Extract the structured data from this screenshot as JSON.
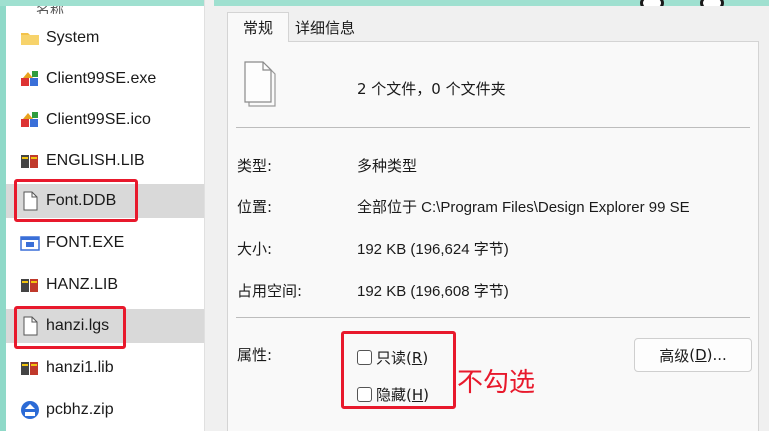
{
  "left_pane": {
    "header": "名称",
    "files": [
      {
        "name": "System",
        "icon": "folder-icon"
      },
      {
        "name": "Client99SE.exe",
        "icon": "exe-app-icon"
      },
      {
        "name": "Client99SE.ico",
        "icon": "exe-app-icon"
      },
      {
        "name": "ENGLISH.LIB",
        "icon": "library-book-icon"
      },
      {
        "name": "Font.DDB",
        "icon": "blank-file-icon"
      },
      {
        "name": "FONT.EXE",
        "icon": "window-exe-icon"
      },
      {
        "name": "HANZ.LIB",
        "icon": "library-book-icon"
      },
      {
        "name": "hanzi.lgs",
        "icon": "blank-file-icon"
      },
      {
        "name": "hanzi1.lib",
        "icon": "library-book-icon"
      },
      {
        "name": "pcbhz.zip",
        "icon": "zip-archive-icon"
      }
    ]
  },
  "properties": {
    "tabs": [
      {
        "label": "常规"
      },
      {
        "label": "详细信息"
      }
    ],
    "summary": "2 个文件，0 个文件夹",
    "type_label": "类型:",
    "type_value": "多种类型",
    "location_label": "位置:",
    "location_value": "全部位于 C:\\Program Files\\Design Explorer 99 SE",
    "size_label": "大小:",
    "size_value": "192 KB (196,624 字节)",
    "disk_label": "占用空间:",
    "disk_value": "192 KB (196,608 字节)",
    "attributes_label": "属性:",
    "readonly_label": "只读",
    "readonly_key": "R",
    "hidden_label": "隐藏",
    "hidden_key": "H",
    "advanced_label": "高级",
    "advanced_key": "D",
    "advanced_suffix": "..."
  },
  "annotation": {
    "text": "不勾选",
    "color": "#e8192c"
  }
}
